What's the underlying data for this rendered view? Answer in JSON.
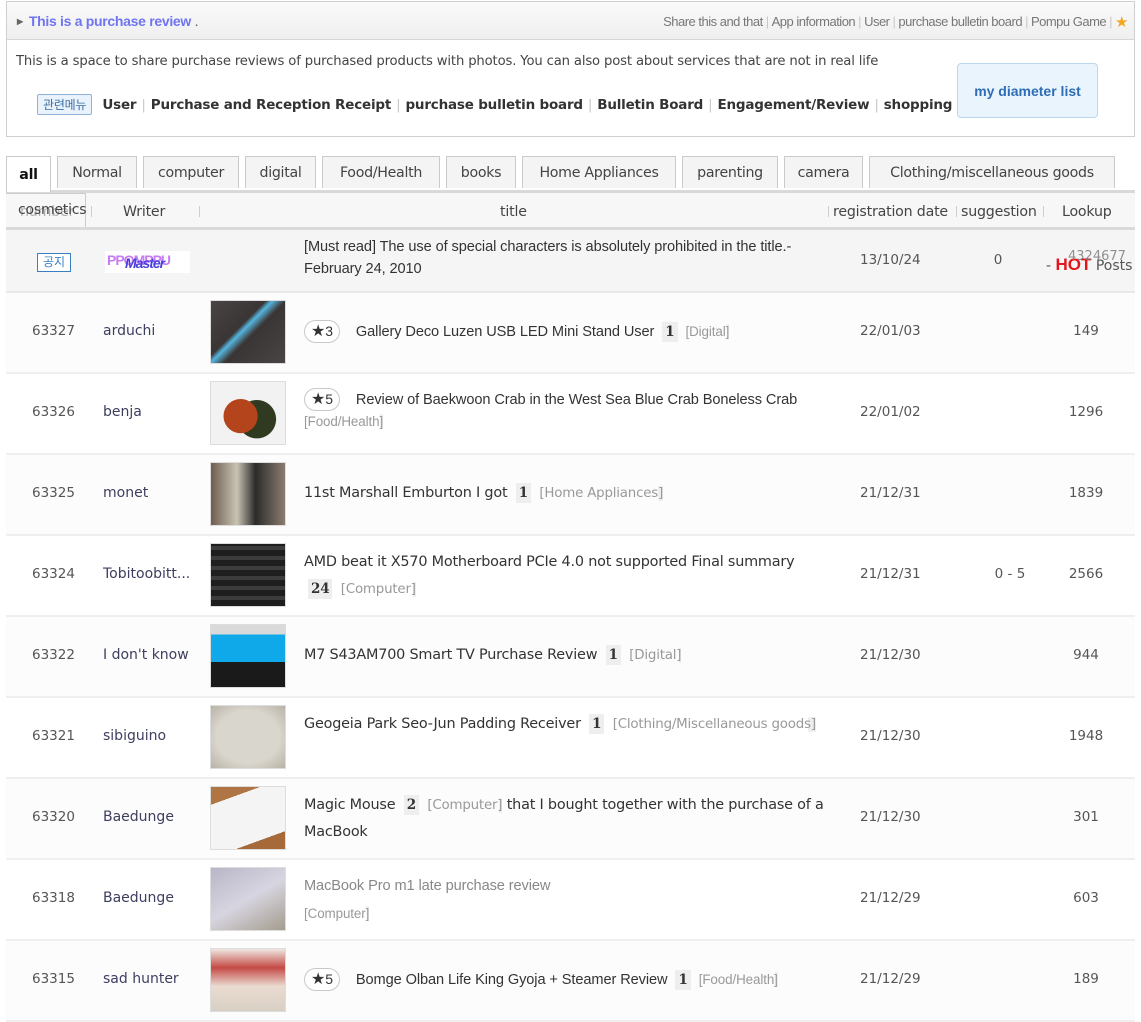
{
  "header": {
    "title": "This is a purchase review",
    "title_suffix": ".",
    "links": [
      "Share this and that",
      "App information",
      "User",
      "purchase bulletin board",
      "Pompu Game"
    ],
    "favorite_icon": "star-icon",
    "description": "This is a space to share purchase reviews of purchased products with photos. You can also post about services that are not in real life",
    "related_menu_badge": "관련메뉴",
    "related_menu": [
      "User",
      "Purchase and Reception Receipt",
      "purchase bulletin board",
      "Bulletin Board",
      "Engagement/Review",
      "shopping"
    ],
    "my_list_button": "my diameter list"
  },
  "tabs": [
    {
      "label": "all",
      "active": true
    },
    {
      "label": "Normal"
    },
    {
      "label": "computer"
    },
    {
      "label": "digital"
    },
    {
      "label": "Food/Health"
    },
    {
      "label": "books"
    },
    {
      "label": "Home Appliances"
    },
    {
      "label": "parenting"
    },
    {
      "label": "camera"
    },
    {
      "label": "Clothing/miscellaneous goods"
    },
    {
      "label": "cosmetics"
    }
  ],
  "columns": {
    "number": "number",
    "writer": "Writer",
    "title": "title",
    "date": "registration date",
    "suggestion": "suggestion",
    "lookup": "Lookup"
  },
  "notice": {
    "badge": "공지",
    "writer_logo": "PPOMPPU Master",
    "title": "[Must read] The use of special characters is absolutely prohibited in the title.- February 24, 2010",
    "date": "13/10/24",
    "suggestion": "0",
    "lookup": "4324677",
    "hot_prefix": "-",
    "hot_label": "HOT",
    "hot_suffix": "Posts",
    "hot_color": "#e3161c"
  },
  "posts": [
    {
      "number": "63327",
      "writer": "arduchi",
      "rating": "3",
      "title": "Gallery Deco Luzen USB LED Mini Stand User",
      "comments": "1",
      "category": "[Digital]",
      "title_after": "",
      "date": "22/01/03",
      "suggestion": "",
      "lookup": "149"
    },
    {
      "number": "63326",
      "writer": "benja",
      "rating": "5",
      "title": "Review of Baekwoon Crab in the West Sea Blue Crab Boneless Crab",
      "comments": "",
      "category": "[Food/Health]",
      "title_after": "",
      "date": "22/01/02",
      "suggestion": "",
      "lookup": "1296"
    },
    {
      "number": "63325",
      "writer": "monet",
      "rating": "",
      "title": "11st Marshall Emburton I got",
      "comments": "1",
      "category": "[Home Appliances]",
      "title_after": "",
      "date": "21/12/31",
      "suggestion": "",
      "lookup": "1839"
    },
    {
      "number": "63324",
      "writer": "Tobitoobitt...",
      "rating": "",
      "title": "AMD beat it X570 Motherboard PCIe 4.0 not supported Final summary",
      "comments": "24",
      "category": "[Computer]",
      "title_after": "",
      "date": "21/12/31",
      "suggestion": "0 - 5",
      "lookup": "2566"
    },
    {
      "number": "63322",
      "writer": "I don't know",
      "rating": "",
      "title": "M7 S43AM700 Smart TV Purchase Review",
      "comments": "1",
      "category": "[Digital]",
      "title_after": "",
      "date": "21/12/30",
      "suggestion": "",
      "lookup": "944"
    },
    {
      "number": "63321",
      "writer": "sibiguino",
      "rating": "",
      "title": "Geogeia Park Seo-Jun Padding Receiver",
      "comments": "1",
      "category": "[Clothing/Miscellaneous goods]",
      "title_after": "",
      "date": "21/12/30",
      "suggestion": "",
      "lookup": "1948"
    },
    {
      "number": "63320",
      "writer": "Baedunge",
      "rating": "",
      "title": "Magic Mouse",
      "comments": "2",
      "category": "[Computer]",
      "title_after": "that I bought together with the purchase of a MacBook",
      "date": "21/12/30",
      "suggestion": "",
      "lookup": "301"
    },
    {
      "number": "63318",
      "writer": "Baedunge",
      "rating": "",
      "title": "MacBook Pro m1 late purchase review",
      "comments": "",
      "category": "[Computer]",
      "title_after": "",
      "date": "21/12/29",
      "suggestion": "",
      "lookup": "603"
    },
    {
      "number": "63315",
      "writer": "sad hunter",
      "rating": "5",
      "title": "Bomge Olban Life King Gyoja + Steamer Review",
      "comments": "1",
      "category": "[Food/Health]",
      "title_after": "",
      "date": "21/12/29",
      "suggestion": "",
      "lookup": "189"
    }
  ]
}
